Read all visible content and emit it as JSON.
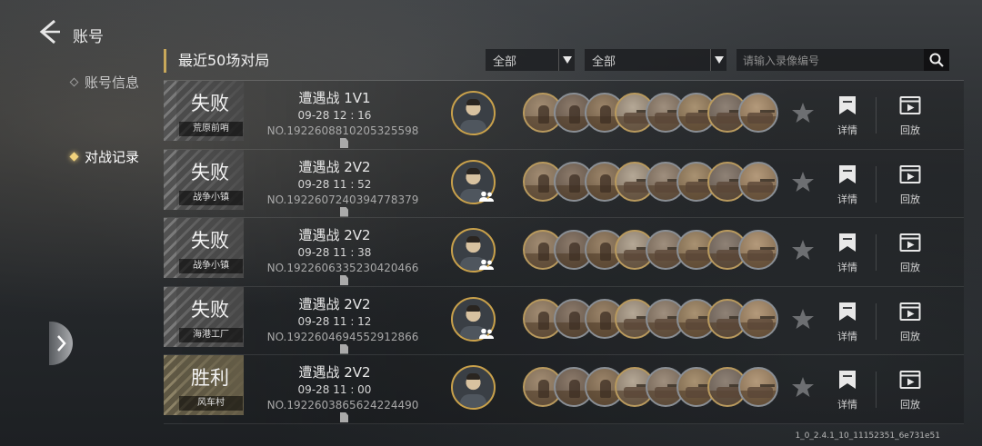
{
  "header": {
    "title": "账号"
  },
  "sidebar": {
    "items": [
      {
        "label": "账号信息",
        "active": false
      },
      {
        "label": "对战记录",
        "active": true
      }
    ]
  },
  "main": {
    "section_title": "最近50场对局",
    "filter1": "全部",
    "filter2": "全部",
    "search_placeholder": "请输入录像编号",
    "detail_label": "详情",
    "replay_label": "回放",
    "matches": [
      {
        "result": "失败",
        "map": "荒原前哨",
        "mode": "遭遇战 1V1",
        "time": "09-28  12 : 16",
        "no": "NO.1922608810205325598",
        "team": false
      },
      {
        "result": "失败",
        "map": "战争小镇",
        "mode": "遭遇战 2V2",
        "time": "09-28  11 : 52",
        "no": "NO.1922607240394778379",
        "team": true
      },
      {
        "result": "失败",
        "map": "战争小镇",
        "mode": "遭遇战 2V2",
        "time": "09-28  11 : 38",
        "no": "NO.1922606335230420466",
        "team": true
      },
      {
        "result": "失败",
        "map": "海港工厂",
        "mode": "遭遇战 2V2",
        "time": "09-28  11 : 12",
        "no": "NO.1922604694552912866",
        "team": true
      },
      {
        "result": "胜利",
        "map": "风车村",
        "mode": "遭遇战 2V2",
        "time": "09-28  11 : 00",
        "no": "NO.1922603865624224490",
        "team": false
      }
    ]
  },
  "version": "1_0_2.4.1_10_11152351_6e731e51",
  "colors": {
    "accent": "#c8a85a",
    "win_tile": "#8c8266",
    "lose_tile": "#6a6a6a"
  },
  "icons": {
    "back": "chevron-left-icon",
    "search": "search-icon",
    "star": "star-icon",
    "detail": "bookmark-icon",
    "replay": "play-icon",
    "expand": "chevron-right-icon",
    "team": "team-icon",
    "copy": "copy-icon"
  }
}
